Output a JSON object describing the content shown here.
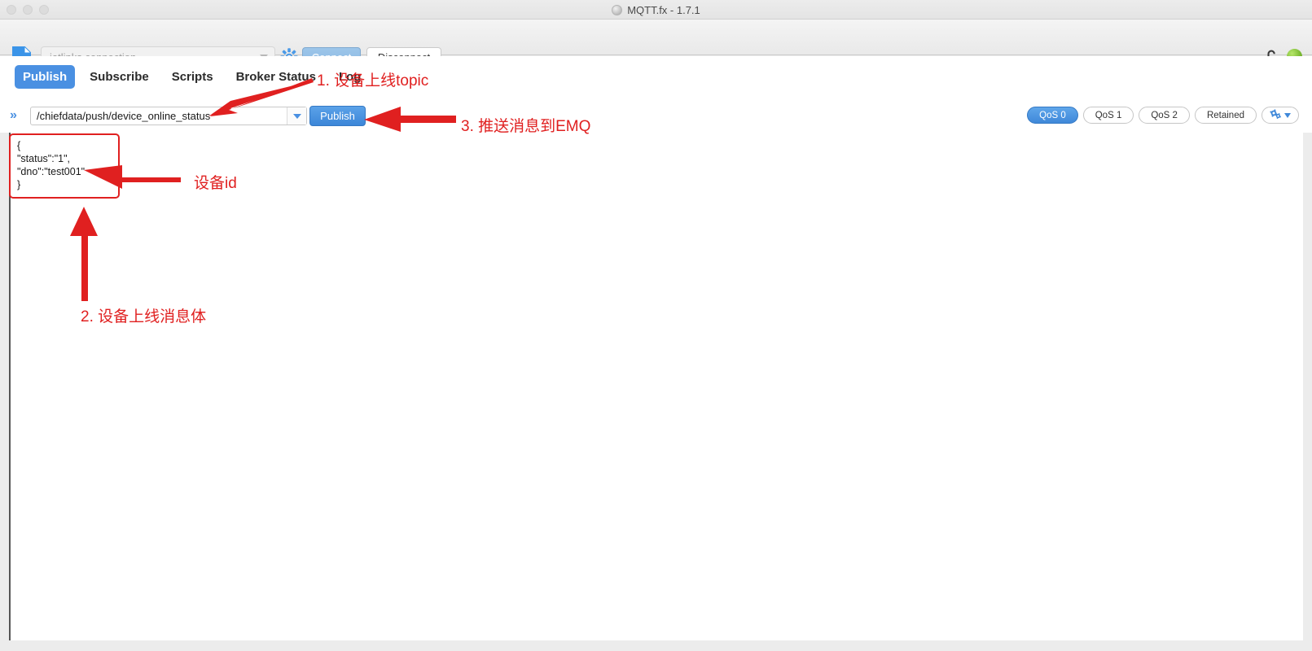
{
  "window": {
    "title": "MQTT.fx - 1.7.1",
    "traffic_lights": [
      "close",
      "minimize",
      "zoom"
    ]
  },
  "connection_bar": {
    "doc_icon": "document-icon",
    "profile_value": "jetlinks connection",
    "profile_placeholder": "jetlinks connection",
    "gear_icon": "gear-icon",
    "connect_label": "Connect",
    "disconnect_label": "Disconnect",
    "lock_icon": "unlocked-padlock-icon",
    "status_led": "connected-green-led",
    "accent": "#4a90e2",
    "led_color": "#74b52c"
  },
  "tabs": [
    {
      "label": "Publish",
      "active": true
    },
    {
      "label": "Subscribe",
      "active": false
    },
    {
      "label": "Scripts",
      "active": false
    },
    {
      "label": "Broker Status",
      "active": false
    },
    {
      "label": "Log",
      "active": false
    }
  ],
  "publish_bar": {
    "expand_icon": "double-chevron-right-icon",
    "topic_value": "/chiefdata/push/device_online_status",
    "topic_dropdown_icon": "chevron-down-icon",
    "publish_label": "Publish",
    "options": [
      {
        "label": "QoS 0",
        "selected": true
      },
      {
        "label": "QoS 1",
        "selected": false
      },
      {
        "label": "QoS 2",
        "selected": false
      },
      {
        "label": "Retained",
        "selected": false
      }
    ],
    "settings_icon": "gears-dropdown-icon"
  },
  "message": {
    "lines": [
      "{",
      "\"status\":\"1\",",
      "\"dno\":\"test001\"",
      "}"
    ],
    "body": "{\n\"status\":\"1\",\n\"dno\":\"test001\"\n}"
  },
  "annotations": {
    "color": "#e02020",
    "step1": "1. 设备上线topic",
    "step2": "2. 设备上线消息体",
    "step3": "3. 推送消息到EMQ",
    "device_id": "设备id"
  }
}
